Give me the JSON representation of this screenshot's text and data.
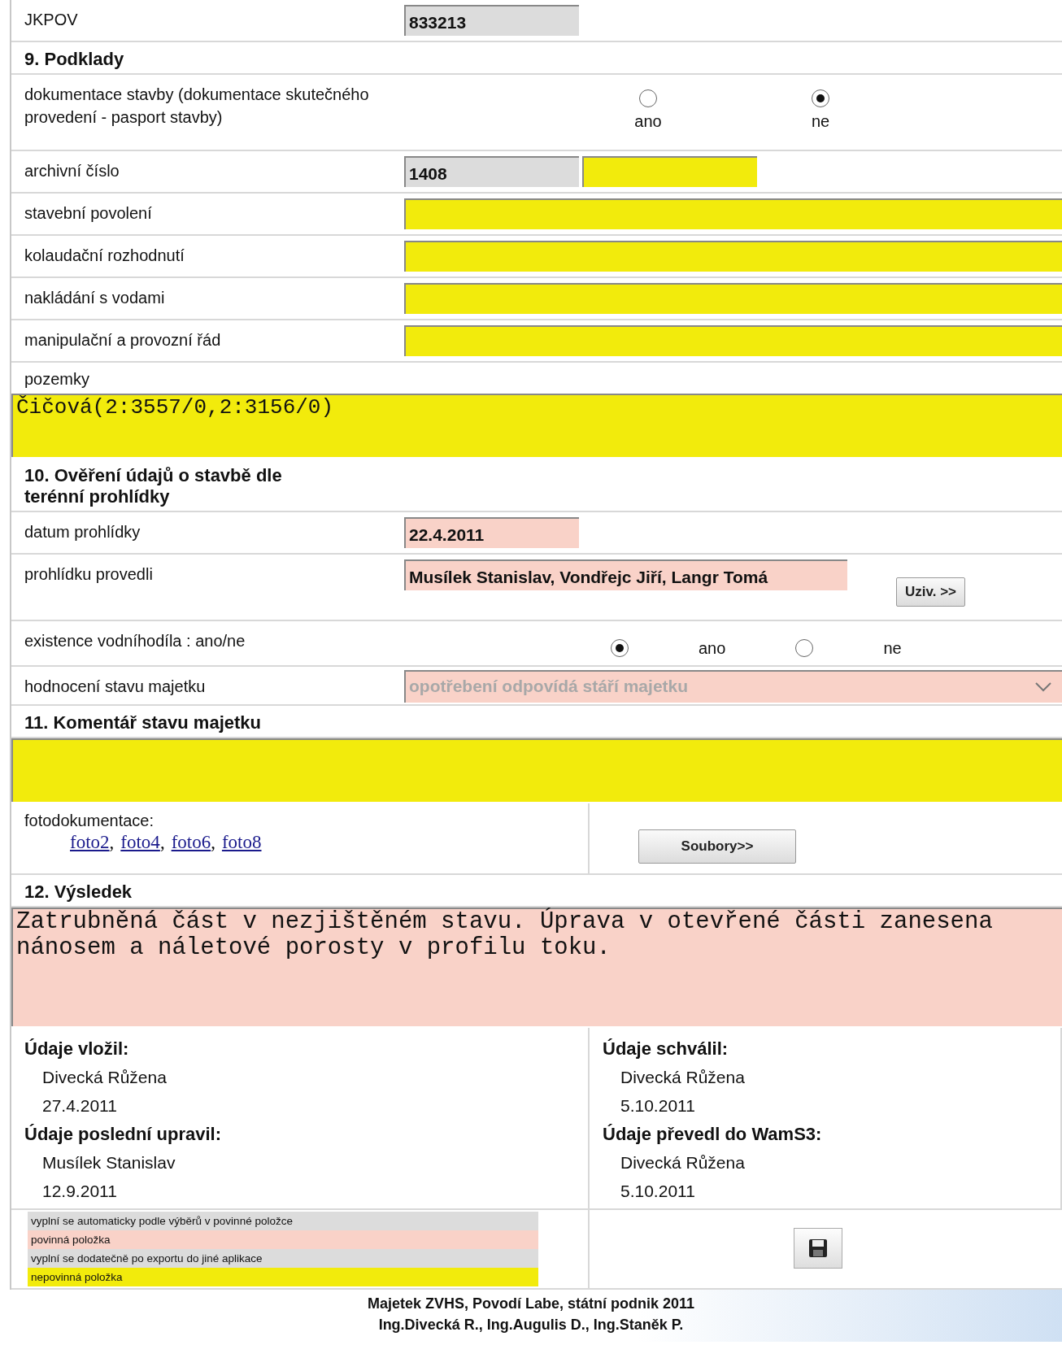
{
  "rows": [
    {
      "kind": "short_field",
      "label": "JKPOV",
      "fields": [
        {
          "value": "833213",
          "color": "#dcdcdc"
        }
      ]
    },
    {
      "kind": "header",
      "title": "9. Podklady"
    },
    {
      "kind": "radio_stacked",
      "label": "dokumentace stavby (dokumentace skutečného provedení - pasport stavby)",
      "options": [
        {
          "label": "ano",
          "selected": false
        },
        {
          "label": "ne",
          "selected": true
        }
      ]
    },
    {
      "kind": "short_field",
      "label": "archivní číslo",
      "fields": [
        {
          "value": "1408",
          "color": "#dcdcdc"
        },
        {
          "color": "#f2eb0c"
        }
      ]
    },
    {
      "kind": "wide_field",
      "label": "stavební povolení",
      "color": "#f2eb0c"
    },
    {
      "kind": "wide_field",
      "label": "kolaudační rozhodnutí",
      "color": "#f2eb0c"
    },
    {
      "kind": "wide_field",
      "label": "nakládání s vodami",
      "color": "#f2eb0c"
    },
    {
      "kind": "wide_field",
      "label": "manipulační a provozní řád",
      "color": "#f2eb0c"
    },
    {
      "kind": "textarea",
      "label": "pozemky",
      "value": "Čičová(2:3557/0,2:3156/0)",
      "color": "#f2eb0c"
    },
    {
      "kind": "header_wrapped",
      "title": "10. Ověření údajů o stavbě dle terénní prohlídky"
    },
    {
      "kind": "short_field",
      "label": "datum prohlídky",
      "fields": [
        {
          "value": "22.4.2011",
          "color": "#f9d2c8"
        }
      ]
    },
    {
      "kind": "users",
      "label": "prohlídku provedli",
      "value": "Musílek Stanislav, Vondřejc Jiří, Langr Tomá",
      "color": "#f9d2c8",
      "button": "Uziv. >>"
    },
    {
      "kind": "radio_inline",
      "label": "existence vodníhodíla : ano/ne",
      "options": [
        {
          "label": "ano",
          "selected": true
        },
        {
          "label": "ne",
          "selected": false
        }
      ]
    },
    {
      "kind": "select",
      "label": "hodnocení stavu majetku",
      "value": "opotřebení odpovídá stáří majetku",
      "color": "#f9d2c8",
      "disabled": true
    },
    {
      "kind": "header",
      "title": "11. Komentář stavu majetku"
    },
    {
      "kind": "textarea",
      "color": "#f2eb0c"
    },
    {
      "kind": "photos",
      "label": "fotodokumentace:",
      "links": [
        {
          "text": "foto2",
          "suffix": ","
        },
        {
          "text": "foto4",
          "suffix": ","
        },
        {
          "text": "foto6",
          "suffix": ","
        },
        {
          "text": "foto8"
        }
      ],
      "button": "Soubory>>"
    },
    {
      "kind": "header",
      "title": "12. Výsledek"
    },
    {
      "kind": "result_box",
      "value": "Zatrubněná část v nezjištěném stavu. Úprava v otevřené části zanesena nánosem a náletové porosty v profilu toku.",
      "color": "#f9d2c8"
    },
    {
      "kind": "audit",
      "columns": [
        [
          {
            "title": "Údaje vložil:",
            "name": "Divecká Růžena",
            "date": "27.4.2011"
          },
          {
            "title": "Údaje poslední upravil:",
            "name": "Musílek Stanislav",
            "date": "12.9.2011"
          }
        ],
        [
          {
            "title": "Údaje schválil:",
            "name": "Divecká Růžena",
            "date": "5.10.2011"
          },
          {
            "title": "Údaje převedl do WamS3:",
            "name": "Divecká Růžena",
            "date": "5.10.2011"
          }
        ]
      ]
    },
    {
      "kind": "legend",
      "items": [
        {
          "text": "vyplní se automaticky podle výběrů v povinné položce",
          "color": "#dcdcdc"
        },
        {
          "text": "povinná položka",
          "color": "#f9d2c8"
        },
        {
          "text": "vyplní se dodatečně po exportu do jiné aplikace",
          "color": "#dcdcdc"
        },
        {
          "text": "nepovinná položka",
          "color": "#f2eb0c"
        }
      ]
    }
  ],
  "footer": [
    "Majetek ZVHS, Povodí Labe, státní podnik 2011",
    "Ing.Divecká R., Ing.Augulis D., Ing.Staněk P."
  ]
}
